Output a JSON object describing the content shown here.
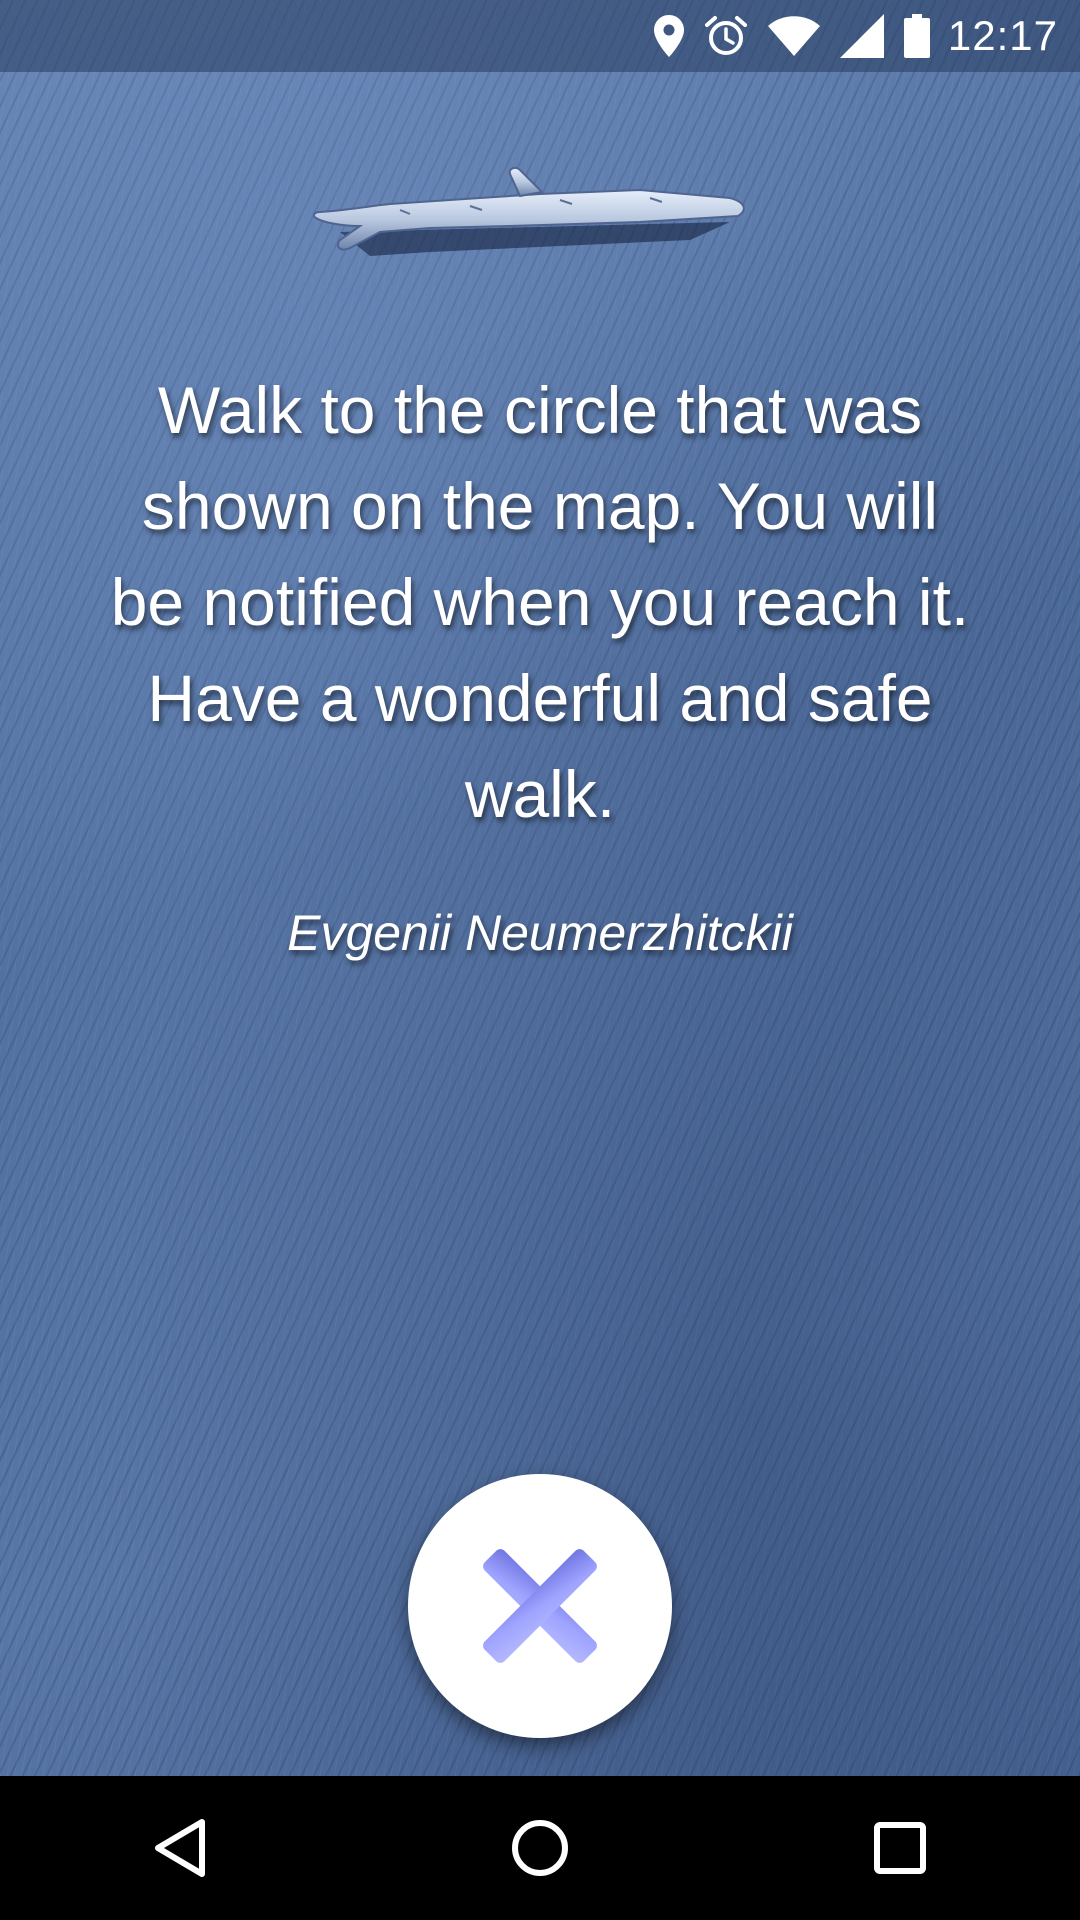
{
  "status_bar": {
    "time": "12:17",
    "icons": [
      "location-icon",
      "alarm-icon",
      "wifi-icon",
      "cellular-signal-icon",
      "battery-icon"
    ]
  },
  "header_image": {
    "icon": "branch-icon"
  },
  "message": {
    "text": "Walk to the circle that was shown on the map. You will be notified when you reach it. Have a wonderful and safe walk.",
    "author": "Evgenii Neumerzhitckii"
  },
  "close_button": {
    "icon": "close-icon",
    "icon_color": "#9ea3ff"
  },
  "nav_bar": {
    "buttons": [
      "back-icon",
      "home-icon",
      "recents-icon"
    ]
  }
}
